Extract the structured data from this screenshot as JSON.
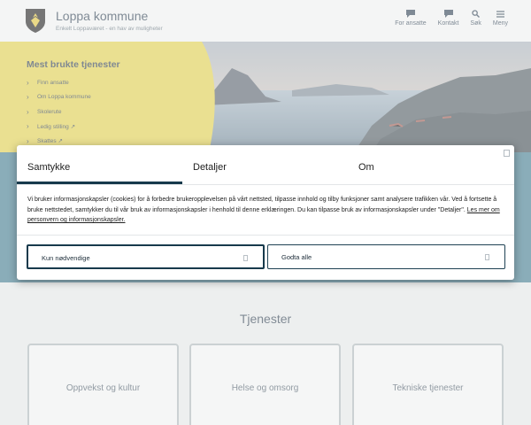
{
  "site": {
    "title": "Loppa kommune",
    "tagline": "Enkelt Loppaværet - en hav av muligheter"
  },
  "nav": [
    {
      "label": "For ansatte",
      "icon": "chat-icon"
    },
    {
      "label": "Kontakt",
      "icon": "chat-icon"
    },
    {
      "label": "Søk",
      "icon": "search-icon"
    },
    {
      "label": "Meny",
      "icon": "menu-icon"
    }
  ],
  "services_panel": {
    "title": "Mest brukte tjenester",
    "items": [
      "Finn ansatte",
      "Om Loppa kommune",
      "Skolerute",
      "Ledig stilling ↗",
      "Skattes ↗"
    ]
  },
  "tjenester": {
    "title": "Tjenester",
    "cards": [
      "Oppvekst og kultur",
      "Helse og omsorg",
      "Tekniske tjenester"
    ]
  },
  "dialog": {
    "tabs": [
      "Samtykke",
      "Detaljer",
      "Om"
    ],
    "text": "Vi bruker informasjonskapsler (cookies) for å forbedre brukeropplevelsen på vårt nettsted, tilpasse innhold og tilby funksjoner samt analysere trafikken vår. Ved å fortsette å bruke nettstedet, samtykker du til vår bruk av informasjonskapsler i henhold til denne erklæringen. Du kan tilpasse bruk av informasjonskapsler under \"Detaljer\".",
    "link": "Les mer om personvern og informasjonskapsler.",
    "buttons": {
      "necessary": "Kun nødvendige",
      "accept_all": "Godta alle"
    }
  },
  "colors": {
    "panel_yellow": "#e3d24a",
    "teal_band": "#3e7b8f",
    "dialog_accent": "#173a4c"
  }
}
